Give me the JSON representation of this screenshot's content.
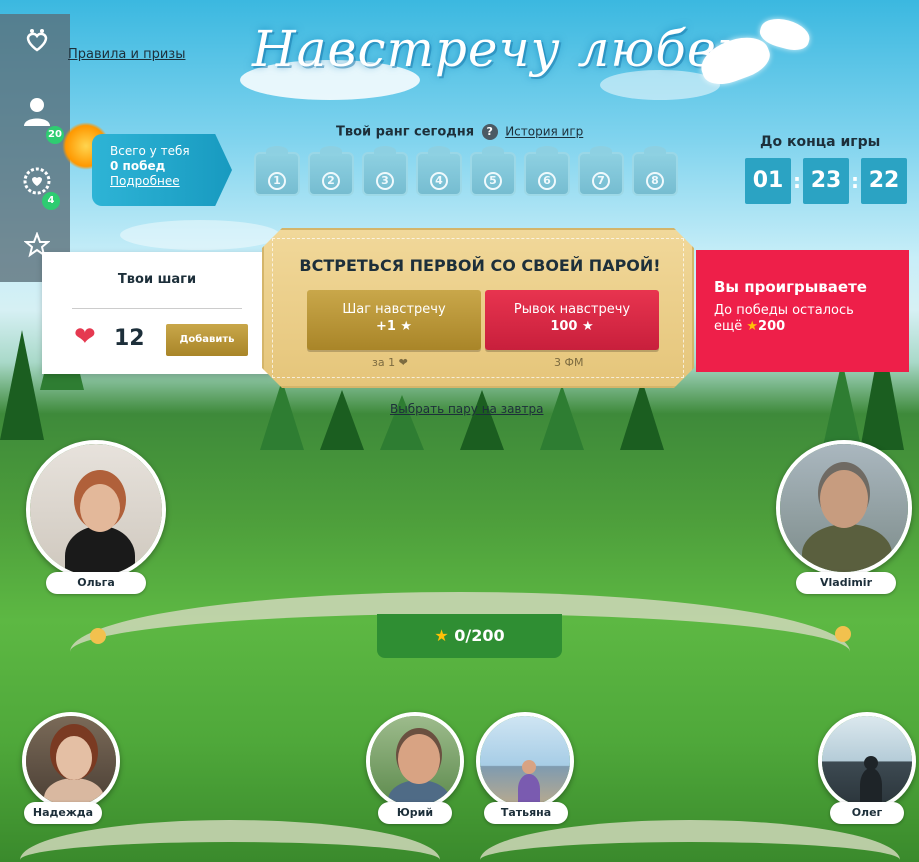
{
  "sidebar": {
    "items": [
      {
        "icon": "hearts-icon"
      },
      {
        "icon": "user-icon",
        "badge": "20"
      },
      {
        "icon": "wreath-heart-icon",
        "badge": "4"
      },
      {
        "icon": "star-outline-icon"
      }
    ]
  },
  "header": {
    "rules_link": "Правила и призы",
    "logo_text": "Навстречу любви"
  },
  "stats": {
    "line1": "Всего у тебя",
    "line2": "0 побед",
    "more_link": "Подробнее"
  },
  "rank": {
    "title": "Твой ранг сегодня",
    "help": "?",
    "history_link": "История игр",
    "levels": [
      "1",
      "2",
      "3",
      "4",
      "5",
      "6",
      "7",
      "8"
    ]
  },
  "timer": {
    "title": "До конца игры",
    "hours": "01",
    "minutes": "23",
    "seconds": "22",
    "sep": ":"
  },
  "steps": {
    "title": "Твои шаги",
    "count": "12",
    "add_label": "Добавить",
    "heart": "❤"
  },
  "meet": {
    "title": "ВСТРЕТЬСЯ ПЕРВОЙ СО СВОЕЙ ПАРОЙ!",
    "step_btn_line1": "Шаг навстречу",
    "step_btn_line2": "+1 ★",
    "step_cost": "за 1 ❤",
    "dash_btn_line1": "Рывок навстречу",
    "dash_btn_line2": "100 ★",
    "dash_cost": "3 ФМ"
  },
  "status": {
    "title": "Вы проигрываете",
    "line1": "До победы осталось",
    "line2_prefix": "ещё ",
    "star": "★",
    "amount": "200"
  },
  "tomorrow_link": "Выбрать пару на завтра",
  "score": {
    "star": "★",
    "value": "0/200"
  },
  "players": {
    "olga": "Ольга",
    "vladimir": "Vladimir",
    "nadezhda": "Надежда",
    "yuriy": "Юрий",
    "tatiana": "Татьяна",
    "oleg": "Олег"
  }
}
